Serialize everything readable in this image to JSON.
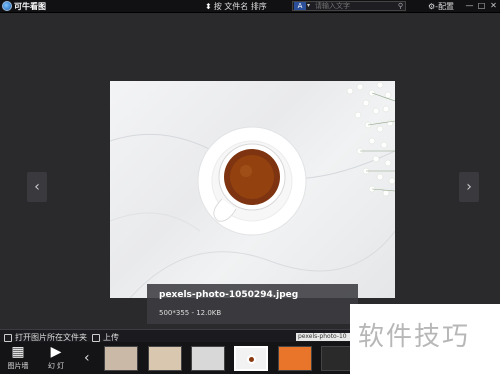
{
  "titlebar": {
    "app_title": "可牛看图",
    "sort_label": "按 文件名 排序",
    "search_placeholder": "请输入文字",
    "config_label": "配置",
    "window_buttons": [
      "—",
      "□",
      "✕"
    ]
  },
  "viewer": {
    "prev_icon": "‹",
    "next_icon": "›"
  },
  "caption": {
    "file_name": "pexels-photo-1050294.jpeg",
    "meta": "500*355  -  12.0KB"
  },
  "strip": {
    "open_folder_label": "打开图片所在文件夹",
    "upload_label": "上传",
    "filename_tag": "pexels-photo-10"
  },
  "toolbar": {
    "wall_label": "图片墙",
    "slideshow_label": "幻 灯",
    "thumbs_prev_icon": "‹"
  },
  "thumbnails": [
    {
      "name": "thumb-1",
      "color": "#c9b9a6"
    },
    {
      "name": "thumb-2",
      "color": "#d9c7b0"
    },
    {
      "name": "thumb-3",
      "color": "#d8d8d8"
    },
    {
      "name": "thumb-4",
      "color": "#f2f2f2"
    },
    {
      "name": "thumb-5",
      "color": "#e9752a"
    },
    {
      "name": "thumb-6",
      "color": "#2a2a2a"
    }
  ],
  "watermark": {
    "text": "软件技巧"
  },
  "colors": {
    "background": "#2a2a2d",
    "titlebar": "#111114",
    "tea": "#8a3a10"
  }
}
